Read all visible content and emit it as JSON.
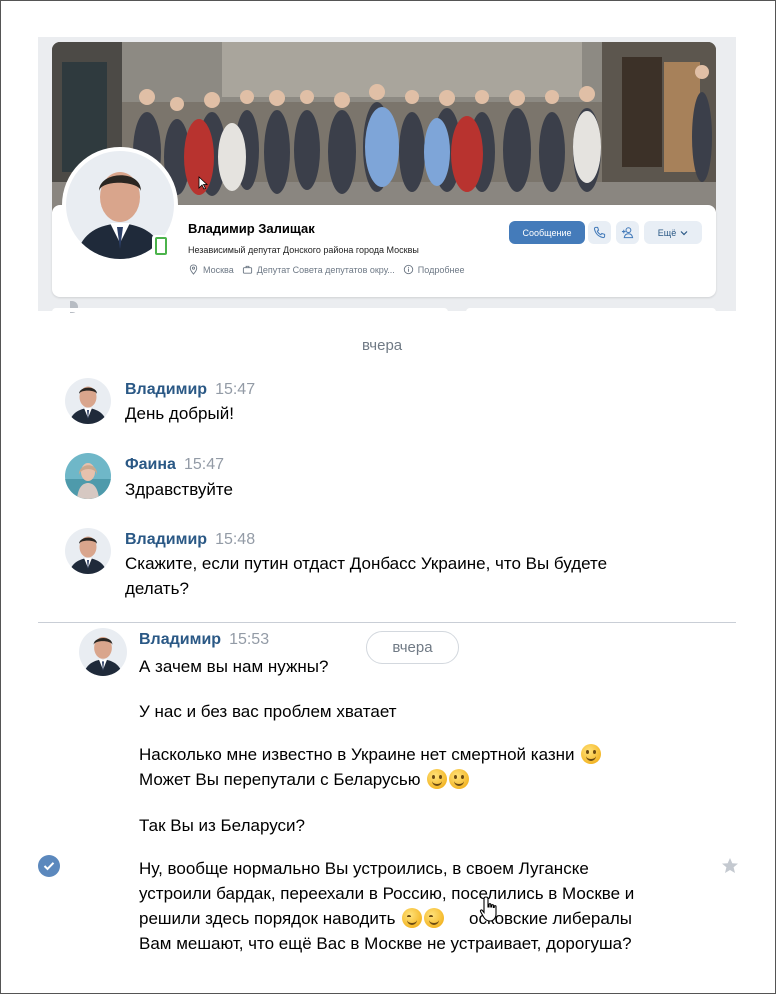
{
  "profile": {
    "name": "Владимир Залищак",
    "status": "Независимый депутат Донского района города Москвы",
    "city": "Москва",
    "job": "Депутат Совета депутатов окру...",
    "more_info": "Подробнее",
    "message_button": "Сообщение",
    "more_button": "Ещё"
  },
  "chat": {
    "date_separator": "вчера",
    "date_pill": "вчера",
    "messages": [
      {
        "author": "Владимир",
        "time": "15:47",
        "text": "День добрый!"
      },
      {
        "author": "Фаина",
        "time": "15:47",
        "text": "Здравствуйте"
      },
      {
        "author": "Владимир",
        "time": "15:48",
        "text_line1": "Скажите, если путин отдаст Донбасс Украине, что Вы будете",
        "text_line2": "делать?"
      },
      {
        "author": "Владимир",
        "time": "15:53",
        "p1": "А зачем вы нам нужны?",
        "p2": "У нас и без вас проблем хватает",
        "p3_line1": "Насколько мне известно в Украине нет смертной казни",
        "p3_line2": "Может Вы перепутали с Беларусью",
        "p4": "Так Вы из Беларуси?",
        "p5_line1": "Ну, вообще нормально Вы устроились, в своем Луганске",
        "p5_line2": "устроили бардак, переехали в Россию, поселились в Москве и",
        "p5_line3a": "решили здесь порядок наводить",
        "p5_line3b": "осковские либералы",
        "p5_line4": "Вам мешают, что ещё Вас в Москве не устраивает, дорогуша?"
      }
    ]
  },
  "icons": [
    "location-icon",
    "briefcase-icon",
    "info-icon",
    "phone-icon",
    "add-friend-icon",
    "chevron-down-icon",
    "check-icon",
    "star-icon",
    "hand-cursor-icon"
  ],
  "colors": {
    "accent": "#447bba",
    "author": "#2a5885",
    "muted": "#939ba6"
  }
}
